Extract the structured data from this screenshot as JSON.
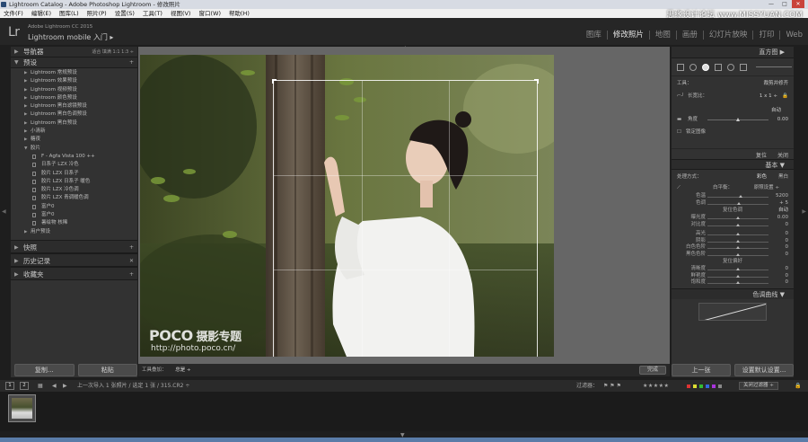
{
  "window": {
    "title": "Lightroom Catalog - Adobe Photoshop Lightroom - 修改照片",
    "watermark": "思缘设计论坛 www.MISSYUAN.COM",
    "controls": [
      "—",
      "□",
      "✕"
    ]
  },
  "menu": [
    "文件(F)",
    "编辑(E)",
    "图库(L)",
    "照片(P)",
    "设置(S)",
    "工具(T)",
    "视图(V)",
    "窗口(W)",
    "帮助(H)"
  ],
  "identity": {
    "logo": "Lr",
    "product": "Adobe Lightroom CC 2015",
    "mobile": "Lightroom mobile 入门 ▸"
  },
  "modules": [
    "图库",
    "修改照片",
    "地图",
    "画册",
    "幻灯片放映",
    "打印",
    "Web"
  ],
  "left": {
    "navigator": {
      "title": "导航器",
      "options": "适合  填满  1:1  1:3 ÷"
    },
    "presets": {
      "title": "预设",
      "items": [
        {
          "label": "Lightroom 常规预设",
          "level": 0
        },
        {
          "label": "Lightroom 效果预设",
          "level": 0
        },
        {
          "label": "Lightroom 视频预设",
          "level": 0
        },
        {
          "label": "Lightroom 颜色预设",
          "level": 0
        },
        {
          "label": "Lightroom 黑白滤镜预设",
          "level": 0
        },
        {
          "label": "Lightroom 黑白色调预设",
          "level": 0
        },
        {
          "label": "Lightroom 黑白预设",
          "level": 0
        },
        {
          "label": "小清新",
          "level": 0
        },
        {
          "label": "糖夜",
          "level": 0
        },
        {
          "label": "胶片",
          "level": 0,
          "open": true
        },
        {
          "label": "F - Agfa Vista 100 ++",
          "level": 1
        },
        {
          "label": "日系子 LZX 冷色",
          "level": 1
        },
        {
          "label": "胶片 LZX 日系子",
          "level": 1
        },
        {
          "label": "胶片 LZX 日系子 暖色",
          "level": 1
        },
        {
          "label": "胶片 LZX 冷色调",
          "level": 1
        },
        {
          "label": "胶片 LZX 青调暖色调",
          "level": 1
        },
        {
          "label": "富户0",
          "level": 1
        },
        {
          "label": "富户0",
          "level": 1
        },
        {
          "label": "暑绘物 核稀",
          "level": 1
        },
        {
          "label": "用户预设",
          "level": 0
        }
      ]
    },
    "sections": [
      {
        "title": "快照",
        "icon": "+"
      },
      {
        "title": "历史记录",
        "icon": "✕"
      },
      {
        "title": "收藏夹",
        "icon": "+"
      }
    ],
    "buttons": {
      "copy": "复制...",
      "paste": "粘贴"
    }
  },
  "center": {
    "watermark_logo": "POCO",
    "watermark_cn": "摄影专题",
    "watermark_url": "http://photo.poco.cn/",
    "toolbar_label": "工具叠加：",
    "toolbar_value": "总是 ÷",
    "done": "完成"
  },
  "right": {
    "histogram_title": "直方图",
    "tools_label": "工具：",
    "tools_value": "裁剪并修齐",
    "aspect_label": "长宽比：",
    "aspect_value": "1 x 1 ÷",
    "auto": "自动",
    "angle_label": "角度",
    "angle_value": "0.00",
    "constrain": "锁定图像",
    "reset": "复位",
    "close": "关闭",
    "basic_title": "基本",
    "treatment_label": "处理方式：",
    "treatment_color": "彩色",
    "treatment_bw": "黑白",
    "wb_label": "白平衡：",
    "wb_value": "原照设置 ÷",
    "wb_rows": [
      {
        "label": "色温",
        "value": "5200",
        "pos": 0.55
      },
      {
        "label": "色调",
        "value": "+ 5",
        "pos": 0.52
      }
    ],
    "tone_title": "色调",
    "tone_prefix": "复位",
    "tone_auto": "自动",
    "tone_rows": [
      {
        "label": "曝光度",
        "value": "0.00",
        "pos": 0.5
      },
      {
        "label": "对比度",
        "value": "0",
        "pos": 0.5
      }
    ],
    "tone_rows2": [
      {
        "label": "高光",
        "value": "0",
        "pos": 0.5
      },
      {
        "label": "阴影",
        "value": "0",
        "pos": 0.5
      },
      {
        "label": "白色色阶",
        "value": "0",
        "pos": 0.5
      },
      {
        "label": "黑色色阶",
        "value": "0",
        "pos": 0.5
      }
    ],
    "presence_title": "偏好",
    "presence_prefix": "复位",
    "presence_rows": [
      {
        "label": "清晰度",
        "value": "0",
        "pos": 0.5
      },
      {
        "label": "鲜艳度",
        "value": "0",
        "pos": 0.5
      },
      {
        "label": "饱和度",
        "value": "0",
        "pos": 0.5
      }
    ],
    "tone_curve_title": "色调曲线",
    "buttons": {
      "prev": "上一张",
      "defaults": "设置默认设置..."
    }
  },
  "filmstrip": {
    "page1": "1",
    "page2": "2",
    "source": "上一次导入   1 张照片 / 选定 1 张 / 315.CR2 ÷",
    "filter_label": "过滤器：",
    "stars": "★★★★★",
    "filter_off": "关闭过滤器 ÷",
    "label_colors": [
      "#d33",
      "#dd3",
      "#3b3",
      "#36d",
      "#a3d",
      "#888"
    ]
  },
  "colors": {
    "panel_bg": "#323232",
    "center_bg": "#666666",
    "accent": "#e8e8e8"
  }
}
